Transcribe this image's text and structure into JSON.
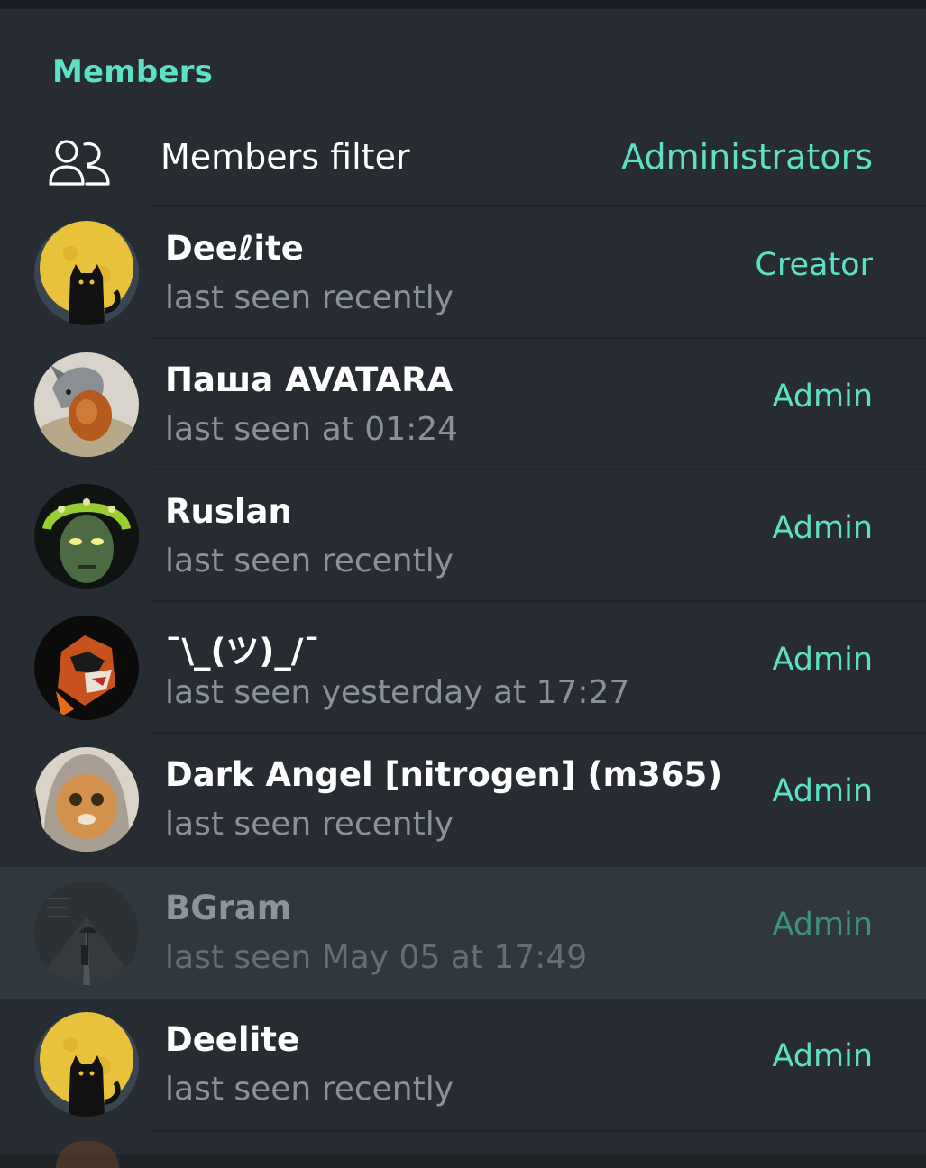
{
  "section_title": "Members",
  "filter": {
    "icon": "members-icon",
    "label": "Members filter",
    "value": "Administrators"
  },
  "members": [
    {
      "name": "Deeℓite",
      "status": "last seen recently",
      "role": "Creator",
      "avatar": "black-cat-moon"
    },
    {
      "name": "Паша AVATARA",
      "status": "last seen at 01:24",
      "role": "Admin",
      "avatar": "wolf-egg"
    },
    {
      "name": "Ruslan",
      "status": "last seen recently",
      "role": "Admin",
      "avatar": "green-mask"
    },
    {
      "name": "¯\\_(ツ)_/¯",
      "status": "last seen yesterday at 17:27",
      "role": "Admin",
      "avatar": "raccoon"
    },
    {
      "name": "Dark Angel [nitrogen] (m365)",
      "status": "last seen recently",
      "role": "Admin",
      "avatar": "cat-hood"
    },
    {
      "name": "BGram",
      "status": "last seen May 05 at 17:49",
      "role": "Admin",
      "avatar": "rain-umbrella"
    },
    {
      "name": "Deelite",
      "status": "last seen recently",
      "role": "Admin",
      "avatar": "black-cat-moon"
    }
  ],
  "colors": {
    "accent": "#5ee0c6",
    "background": "#262c31",
    "highlight_row": "#30373d",
    "secondary_text": "#8a9197"
  }
}
